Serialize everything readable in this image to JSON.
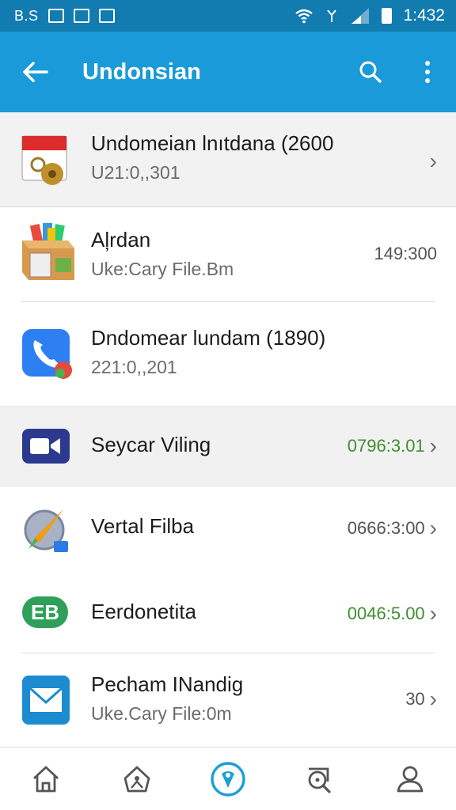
{
  "status_bar": {
    "carrier": "B.S",
    "time": "1:432"
  },
  "app_bar": {
    "title": "Undonsian"
  },
  "list": [
    {
      "title": "Undomeian lnıtdana (2600",
      "subtitle": "U21:0,,301",
      "meta": "",
      "icon": "calendar-document-icon"
    },
    {
      "title": "Aļrdan",
      "subtitle": "Uke:Cary File.Bm",
      "meta": "149:300",
      "icon": "package-box-icon"
    },
    {
      "title": "Dndomear lundam (1890)",
      "subtitle": "221:0,,201",
      "meta": "",
      "icon": "phone-call-icon"
    },
    {
      "title": "Seycar Viling",
      "subtitle": "",
      "meta": "0796:3.01",
      "icon": "video-camera-icon"
    },
    {
      "title": "Vertal Filba",
      "subtitle": "",
      "meta": "0666:3:00",
      "icon": "compass-browser-icon"
    },
    {
      "title": "Eerdonetita",
      "subtitle": "",
      "meta": "0046:5.00",
      "icon": "eb-badge-icon",
      "badge_text": "EB"
    },
    {
      "title": "Pecham INandig",
      "subtitle": "Uke.Cary File:0m",
      "meta": "30",
      "icon": "mail-envelope-icon"
    }
  ],
  "bottom_nav": [
    "home-icon",
    "tag-icon",
    "location-pin-icon",
    "search-doc-icon",
    "profile-icon"
  ],
  "colors": {
    "status_bar": "#127bb0",
    "app_bar": "#1a9ad8",
    "meta_green": "#3f8f2f",
    "accent": "#1aa0d8"
  }
}
